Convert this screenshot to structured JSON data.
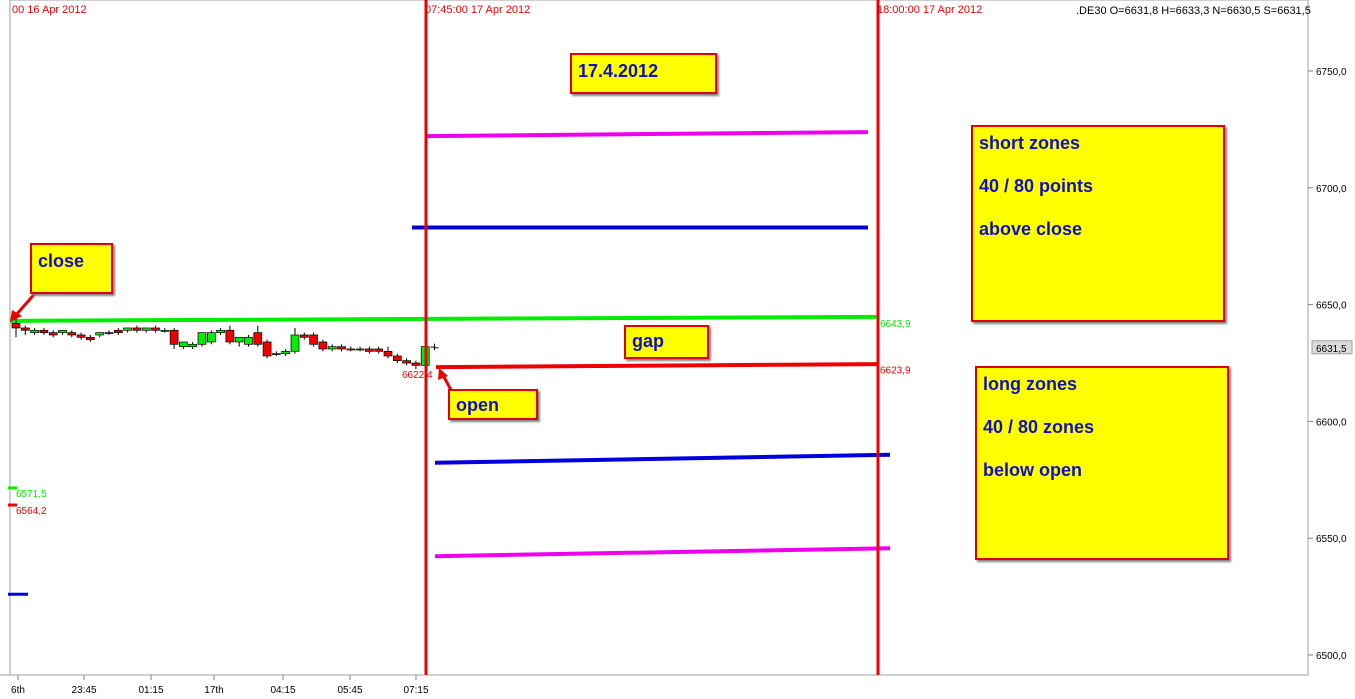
{
  "header": {
    "date_left": "00 16 Apr 2012",
    "date_mid": "07:45:00 17 Apr 2012",
    "date_right": "18:00:00 17 Apr 2012",
    "ohlc": ".DE30 O=6631,8 H=6633,3 N=6630,5 S=6631,5"
  },
  "notes": {
    "date": "17.4.2012",
    "close": "close",
    "open": "open",
    "gap": "gap",
    "short_line1": "short zones",
    "short_line2": "40 / 80 points",
    "short_line3": "above close",
    "long_line1": "long zones",
    "long_line2": "40 / 80 zones",
    "long_line3": "below open"
  },
  "colors": {
    "green": "#00ee00",
    "red": "#ee0000",
    "blue": "#0000dd",
    "magenta": "#ee00ee",
    "note_bg": "#ffff00",
    "note_text": "#1010c0"
  },
  "chart_data": {
    "type": "candlestick",
    "ylim": [
      6490,
      6770
    ],
    "y_ticks": [
      6500,
      6550,
      6600,
      6650,
      6700,
      6750
    ],
    "y_tick_labels": [
      "6500,0",
      "6550,0",
      "6600,0",
      "6650,0",
      "6700,0",
      "6750,0"
    ],
    "current_price_label": "6631,5",
    "current_price": 6631.5,
    "x_tick_labels": [
      "6th",
      "23:45",
      "01:15",
      "17th",
      "04:15",
      "05:45",
      "07:15"
    ],
    "candles": [
      {
        "o": 6642,
        "h": 6644,
        "c": 6640,
        "l": 6636
      },
      {
        "o": 6640,
        "h": 6641,
        "c": 6639,
        "l": 6637
      },
      {
        "o": 6638,
        "h": 6640,
        "c": 6639,
        "l": 6637
      },
      {
        "o": 6639,
        "h": 6640,
        "c": 6638,
        "l": 6637
      },
      {
        "o": 6638,
        "h": 6639,
        "c": 6637,
        "l": 6636
      },
      {
        "o": 6638,
        "h": 6639,
        "c": 6639,
        "l": 6637
      },
      {
        "o": 6638,
        "h": 6639,
        "c": 6637,
        "l": 6636
      },
      {
        "o": 6637,
        "h": 6638,
        "c": 6636,
        "l": 6635
      },
      {
        "o": 6636,
        "h": 6637,
        "c": 6635,
        "l": 6634
      },
      {
        "o": 6637,
        "h": 6638,
        "c": 6638,
        "l": 6636
      },
      {
        "o": 6638,
        "h": 6639,
        "c": 6638,
        "l": 6637
      },
      {
        "o": 6639,
        "h": 6640,
        "c": 6638,
        "l": 6637
      },
      {
        "o": 6639,
        "h": 6640,
        "c": 6640,
        "l": 6638
      },
      {
        "o": 6640,
        "h": 6641,
        "c": 6639,
        "l": 6638
      },
      {
        "o": 6639,
        "h": 6640,
        "c": 6640,
        "l": 6638
      },
      {
        "o": 6640,
        "h": 6641,
        "c": 6639,
        "l": 6638
      },
      {
        "o": 6639,
        "h": 6640,
        "c": 6639,
        "l": 6638
      },
      {
        "o": 6639,
        "h": 6640,
        "c": 6633,
        "l": 6631
      },
      {
        "o": 6632,
        "h": 6633,
        "c": 6634,
        "l": 6631
      },
      {
        "o": 6632,
        "h": 6634,
        "c": 6633,
        "l": 6631
      },
      {
        "o": 6633,
        "h": 6635,
        "c": 6638,
        "l": 6632
      },
      {
        "o": 6634,
        "h": 6639,
        "c": 6638,
        "l": 6633
      },
      {
        "o": 6638,
        "h": 6640,
        "c": 6639,
        "l": 6637
      },
      {
        "o": 6639,
        "h": 6641,
        "c": 6634,
        "l": 6633
      },
      {
        "o": 6634,
        "h": 6635,
        "c": 6636,
        "l": 6632
      },
      {
        "o": 6633,
        "h": 6637,
        "c": 6636,
        "l": 6632
      },
      {
        "o": 6638,
        "h": 6641,
        "c": 6633,
        "l": 6632
      },
      {
        "o": 6634,
        "h": 6635,
        "c": 6628,
        "l": 6627
      },
      {
        "o": 6629,
        "h": 6630,
        "c": 6629,
        "l": 6628
      },
      {
        "o": 6629,
        "h": 6631,
        "c": 6630,
        "l": 6628
      },
      {
        "o": 6630,
        "h": 6640,
        "c": 6637,
        "l": 6629
      },
      {
        "o": 6637,
        "h": 6638,
        "c": 6636,
        "l": 6635
      },
      {
        "o": 6637,
        "h": 6638,
        "c": 6633,
        "l": 6632
      },
      {
        "o": 6634,
        "h": 6635,
        "c": 6631,
        "l": 6630
      },
      {
        "o": 6631,
        "h": 6633,
        "c": 6632,
        "l": 6630
      },
      {
        "o": 6632,
        "h": 6633,
        "c": 6631,
        "l": 6630
      },
      {
        "o": 6631,
        "h": 6632,
        "c": 6631,
        "l": 6630
      },
      {
        "o": 6631,
        "h": 6632,
        "c": 6631,
        "l": 6630
      },
      {
        "o": 6631,
        "h": 6632,
        "c": 6630,
        "l": 6629
      },
      {
        "o": 6631,
        "h": 6632,
        "c": 6630,
        "l": 6629
      },
      {
        "o": 6630,
        "h": 6632,
        "c": 6628,
        "l": 6627
      },
      {
        "o": 6628,
        "h": 6629,
        "c": 6626,
        "l": 6625
      },
      {
        "o": 6626,
        "h": 6627,
        "c": 6625,
        "l": 6624
      },
      {
        "o": 6625,
        "h": 6626,
        "c": 6624,
        "l": 6622.4
      },
      {
        "o": 6624,
        "h": 6633,
        "c": 6632,
        "l": 6622.4
      },
      {
        "o": 6631.8,
        "h": 6633.3,
        "c": 6631.5,
        "l": 6630.5
      }
    ],
    "levels": [
      {
        "name": "close level",
        "value": 6643.9,
        "label": "6643,9",
        "color": "#00ee00"
      },
      {
        "name": "open level",
        "value": 6623.9,
        "label": "6623,9",
        "color": "#ee0000"
      },
      {
        "name": "short zone 40",
        "value": 6683,
        "color": "#0000dd"
      },
      {
        "name": "short zone 80",
        "value": 6723,
        "color": "#ee00ee"
      },
      {
        "name": "long zone 40",
        "value": 6584,
        "color": "#0000dd"
      },
      {
        "name": "long zone 80",
        "value": 6544,
        "color": "#ee00ee"
      }
    ],
    "low_label": "6622,4",
    "low_value": 6622.4,
    "left_labels": [
      {
        "value": 6571.5,
        "label": "6571,5",
        "color": "#00ee00"
      },
      {
        "value": 6564.2,
        "label": "6564,2",
        "color": "#ee0000"
      }
    ],
    "left_blue_value": 6526
  }
}
